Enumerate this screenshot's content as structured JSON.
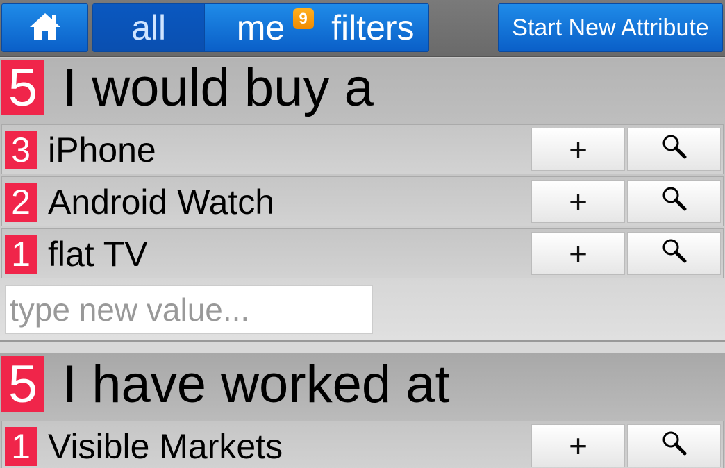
{
  "header": {
    "home_icon": "home-icon",
    "tabs": [
      {
        "label": "all",
        "active": true
      },
      {
        "label": "me",
        "badge": "9"
      },
      {
        "label": "filters"
      }
    ],
    "start_button": "Start New Attribute"
  },
  "attributes": [
    {
      "count": "5",
      "title": "I would buy a",
      "values": [
        {
          "count": "3",
          "label": "iPhone"
        },
        {
          "count": "2",
          "label": "Android Watch"
        },
        {
          "count": "1",
          "label": "flat TV"
        }
      ],
      "new_value_placeholder": "type new value..."
    },
    {
      "count": "5",
      "title": "I have worked at",
      "values": [
        {
          "count": "1",
          "label": "Visible Markets"
        }
      ]
    }
  ],
  "actions": {
    "plus_label": "+",
    "search_icon": "search-icon"
  },
  "colors": {
    "accent": "#0a5fc8",
    "count_badge": "#f0254a",
    "notify_badge": "#f59a0a"
  }
}
